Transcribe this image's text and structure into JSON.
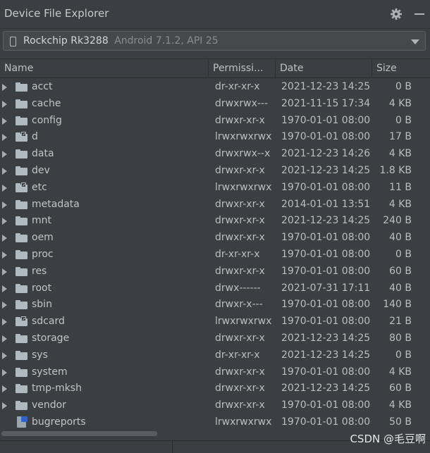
{
  "window": {
    "title": "Device File Explorer"
  },
  "toolbar": {
    "settings_icon": "gear-icon",
    "minimize_icon": "minimize-icon"
  },
  "device": {
    "name": "Rockchip Rk3288",
    "detail": "Android 7.1.2, API 25",
    "icon": "phone-icon"
  },
  "columns": {
    "name": "Name",
    "permissions": "Permissi...",
    "date": "Date",
    "size": "Size"
  },
  "rows": [
    {
      "name": "acct",
      "perm": "dr-xr-xr-x",
      "date": "2021-12-23 14:25",
      "size": "0 B",
      "type": "folder"
    },
    {
      "name": "cache",
      "perm": "drwxrwx---",
      "date": "2021-11-15 17:34",
      "size": "4 KB",
      "type": "folder"
    },
    {
      "name": "config",
      "perm": "drwxr-xr-x",
      "date": "1970-01-01 08:00",
      "size": "0 B",
      "type": "folder"
    },
    {
      "name": "d",
      "perm": "lrwxrwxrwx",
      "date": "1970-01-01 08:00",
      "size": "17 B",
      "type": "folder-link"
    },
    {
      "name": "data",
      "perm": "drwxrwx--x",
      "date": "2021-12-23 14:26",
      "size": "4 KB",
      "type": "folder"
    },
    {
      "name": "dev",
      "perm": "drwxr-xr-x",
      "date": "2021-12-23 14:25",
      "size": "1.8 KB",
      "type": "folder"
    },
    {
      "name": "etc",
      "perm": "lrwxrwxrwx",
      "date": "1970-01-01 08:00",
      "size": "11 B",
      "type": "folder-link"
    },
    {
      "name": "metadata",
      "perm": "drwxr-xr-x",
      "date": "2014-01-01 13:51",
      "size": "4 KB",
      "type": "folder"
    },
    {
      "name": "mnt",
      "perm": "drwxr-xr-x",
      "date": "2021-12-23 14:25",
      "size": "240 B",
      "type": "folder"
    },
    {
      "name": "oem",
      "perm": "drwxr-xr-x",
      "date": "1970-01-01 08:00",
      "size": "40 B",
      "type": "folder"
    },
    {
      "name": "proc",
      "perm": "dr-xr-xr-x",
      "date": "1970-01-01 08:00",
      "size": "0 B",
      "type": "folder"
    },
    {
      "name": "res",
      "perm": "drwxr-xr-x",
      "date": "1970-01-01 08:00",
      "size": "60 B",
      "type": "folder"
    },
    {
      "name": "root",
      "perm": "drwx------",
      "date": "2021-07-31 17:11",
      "size": "40 B",
      "type": "folder"
    },
    {
      "name": "sbin",
      "perm": "drwxr-x---",
      "date": "1970-01-01 08:00",
      "size": "140 B",
      "type": "folder"
    },
    {
      "name": "sdcard",
      "perm": "lrwxrwxrwx",
      "date": "1970-01-01 08:00",
      "size": "21 B",
      "type": "folder-link"
    },
    {
      "name": "storage",
      "perm": "drwxr-xr-x",
      "date": "2021-12-23 14:25",
      "size": "80 B",
      "type": "folder"
    },
    {
      "name": "sys",
      "perm": "dr-xr-xr-x",
      "date": "2021-12-23 14:25",
      "size": "0 B",
      "type": "folder"
    },
    {
      "name": "system",
      "perm": "drwxr-xr-x",
      "date": "1970-01-01 08:00",
      "size": "4 KB",
      "type": "folder"
    },
    {
      "name": "tmp-mksh",
      "perm": "drwxr-xr-x",
      "date": "2021-12-23 14:25",
      "size": "60 B",
      "type": "folder"
    },
    {
      "name": "vendor",
      "perm": "drwxr-xr-x",
      "date": "1970-01-01 08:00",
      "size": "4 KB",
      "type": "folder"
    },
    {
      "name": "bugreports",
      "perm": "lrwxrwxrwx",
      "date": "1970-01-01 08:00",
      "size": "50 B",
      "type": "file-link"
    }
  ],
  "watermark": "CSDN @毛豆啊"
}
